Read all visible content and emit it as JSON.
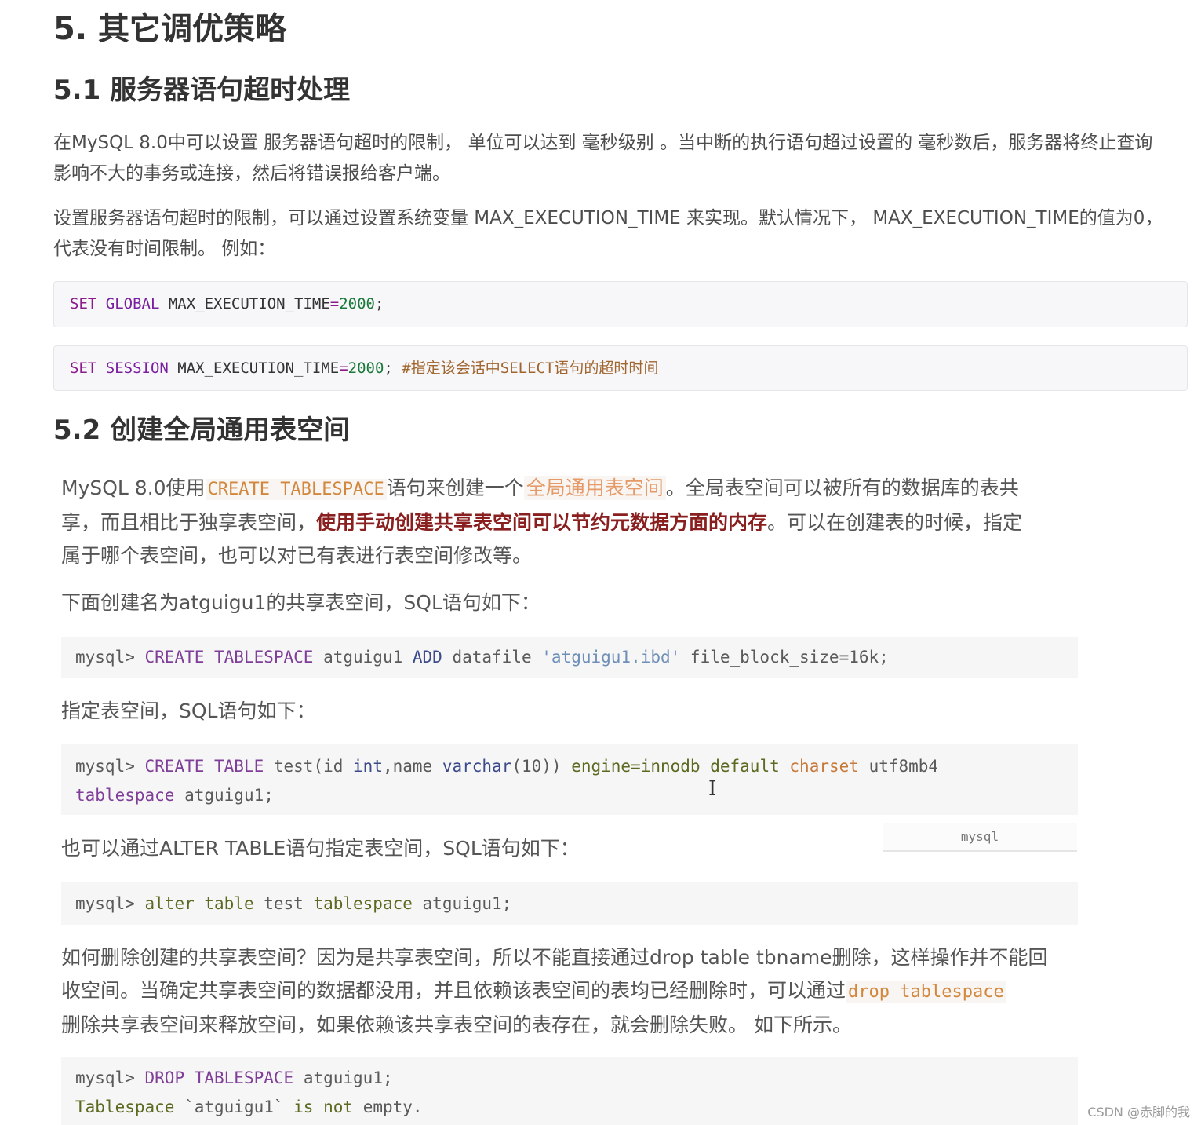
{
  "h1": "5. 其它调优策略",
  "s51": {
    "heading": "5.1 服务器语句超时处理",
    "p1_line1": "在MySQL 8.0中可以设置 服务器语句超时的限制， 单位可以达到 毫秒级别 。当中断的执行语句超过设置的 毫秒数后，服务器将终止查询",
    "p1_line2": "影响不大的事务或连接，然后将错误报给客户端。",
    "p2_line1": "设置服务器语句超时的限制，可以通过设置系统变量 MAX_EXECUTION_TIME 来实现。默认情况下， MAX_EXECUTION_TIME的值为0，",
    "p2_line2": "代表没有时间限制。 例如：",
    "code1": {
      "set": "SET",
      "global": "GLOBAL",
      "var": " MAX_EXECUTION_TIME",
      "eq": "=",
      "val": "2000",
      "end": ";"
    },
    "code2": {
      "set": "SET",
      "session": "SESSION",
      "var": " MAX_EXECUTION_TIME",
      "eq": "=",
      "val": "2000",
      "end": "; ",
      "comment": "#指定该会话中SELECT语句的超时时间"
    }
  },
  "s52": {
    "heading": "5.2 创建全局通用表空间",
    "p1": {
      "a": "MySQL 8.0使用",
      "code": "CREATE TABLESPACE",
      "b": "语句来创建一个",
      "hl": "全局通用表空间",
      "c": "。全局表空间可以被所有的数据库的表共",
      "d": "享，而且相比于独享表空间，",
      "bold": "使用手动创建共享表空间可以节约元数据方面的内存",
      "e": "。可以在创建表的时候，指定",
      "f": "属于哪个表空间，也可以对已有表进行表空间修改等。"
    },
    "p2": "下面创建名为atguigu1的共享表空间，SQL语句如下：",
    "code_a": {
      "prompt": "mysql> ",
      "create": "CREATE TABLESPACE",
      "name": " atguigu1 ",
      "add": "ADD",
      "datafile": " datafile ",
      "str": "'atguigu1.ibd'",
      "rest": " file_block_size=16k;"
    },
    "p3": "指定表空间，SQL语句如下：",
    "code_b": {
      "prompt": "mysql> ",
      "create": "CREATE TABLE",
      "t1": " test(id ",
      "int": "int",
      "t2": ",name ",
      "varchar": "varchar",
      "t3": "(10)) ",
      "engine": "engine=innodb",
      "sp": " ",
      "default": "default",
      "sp2": " ",
      "charset": "charset",
      "t4": " utf8mb4",
      "tablespace": "tablespace",
      "t5": " atguigu1;"
    },
    "p4": "也可以通过ALTER TABLE语句指定表空间，SQL语句如下：",
    "tag": "mysql",
    "code_c": {
      "prompt": "mysql> ",
      "alter": "alter table",
      "t1": " test ",
      "tablespace": "tablespace",
      "t2": " atguigu1;"
    },
    "p5": {
      "l1": "如何删除创建的共享表空间？因为是共享表空间，所以不能直接通过drop table tbname删除，这样操作并不能回",
      "l2a": "收空间。当确定共享表空间的数据都没用，并且依赖该表空间的表均已经删除时，可以通过",
      "l2code": "drop tablespace",
      "l3": "删除共享表空间来释放空间，如果依赖该共享表空间的表存在，就会删除失败。 如下所示。"
    },
    "code_d": {
      "prompt": "mysql> ",
      "drop": "DROP TABLESPACE",
      "t1": " atguigu1;",
      "ts": "Tablespace",
      "t2": " `atguigu1` ",
      "is": "is",
      "sp": " ",
      "not": "not",
      "t3": " empty."
    }
  },
  "watermark": "CSDN @赤脚的我"
}
